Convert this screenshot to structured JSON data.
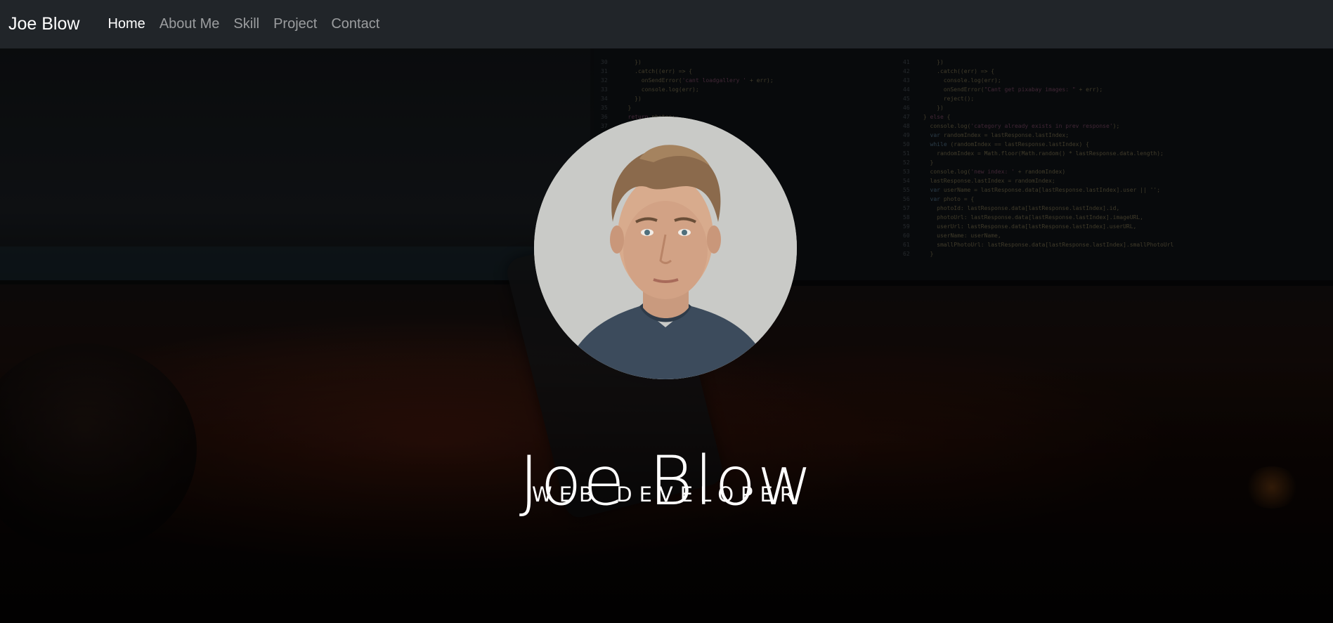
{
  "navbar": {
    "brand": "Joe Blow",
    "items": [
      {
        "label": "Home",
        "active": true
      },
      {
        "label": "About Me",
        "active": false
      },
      {
        "label": "Skill",
        "active": false
      },
      {
        "label": "Project",
        "active": false
      },
      {
        "label": "Contact",
        "active": false
      }
    ]
  },
  "hero": {
    "name": "Joe Blow",
    "role": "Web Developer",
    "avatar_icon": "profile-photo"
  },
  "colors": {
    "navbar_bg": "#212529",
    "nav_active": "#ffffff",
    "nav_inactive": "rgba(255,255,255,0.55)",
    "hero_text": "#ffffff"
  }
}
